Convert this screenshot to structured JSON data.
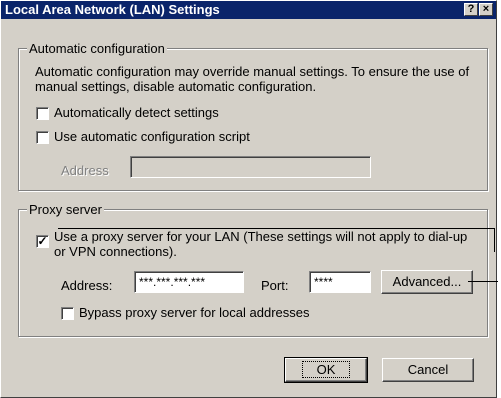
{
  "window": {
    "title": "Local Area Network (LAN) Settings",
    "help_label": "?",
    "close_label": "×"
  },
  "auto_config": {
    "legend": "Automatic configuration",
    "description": "Automatic configuration may override manual settings.  To ensure the use of manual settings, disable automatic configuration.",
    "detect": {
      "label": "Automatically detect settings",
      "checked": false
    },
    "script": {
      "label": "Use automatic configuration script",
      "checked": false
    },
    "address_label": "Address",
    "address_value": ""
  },
  "proxy": {
    "legend": "Proxy server",
    "use_proxy": {
      "label": "Use a proxy server for your LAN (These settings will not apply to dial-up or VPN connections).",
      "checked": true,
      "check_glyph": "✓"
    },
    "address_label": "Address:",
    "address_value": "***.***.***.***",
    "port_label": "Port:",
    "port_value": "****",
    "advanced_label": "Advanced...",
    "bypass": {
      "label": "Bypass proxy server for local addresses",
      "checked": false
    }
  },
  "buttons": {
    "ok": "OK",
    "cancel": "Cancel"
  }
}
